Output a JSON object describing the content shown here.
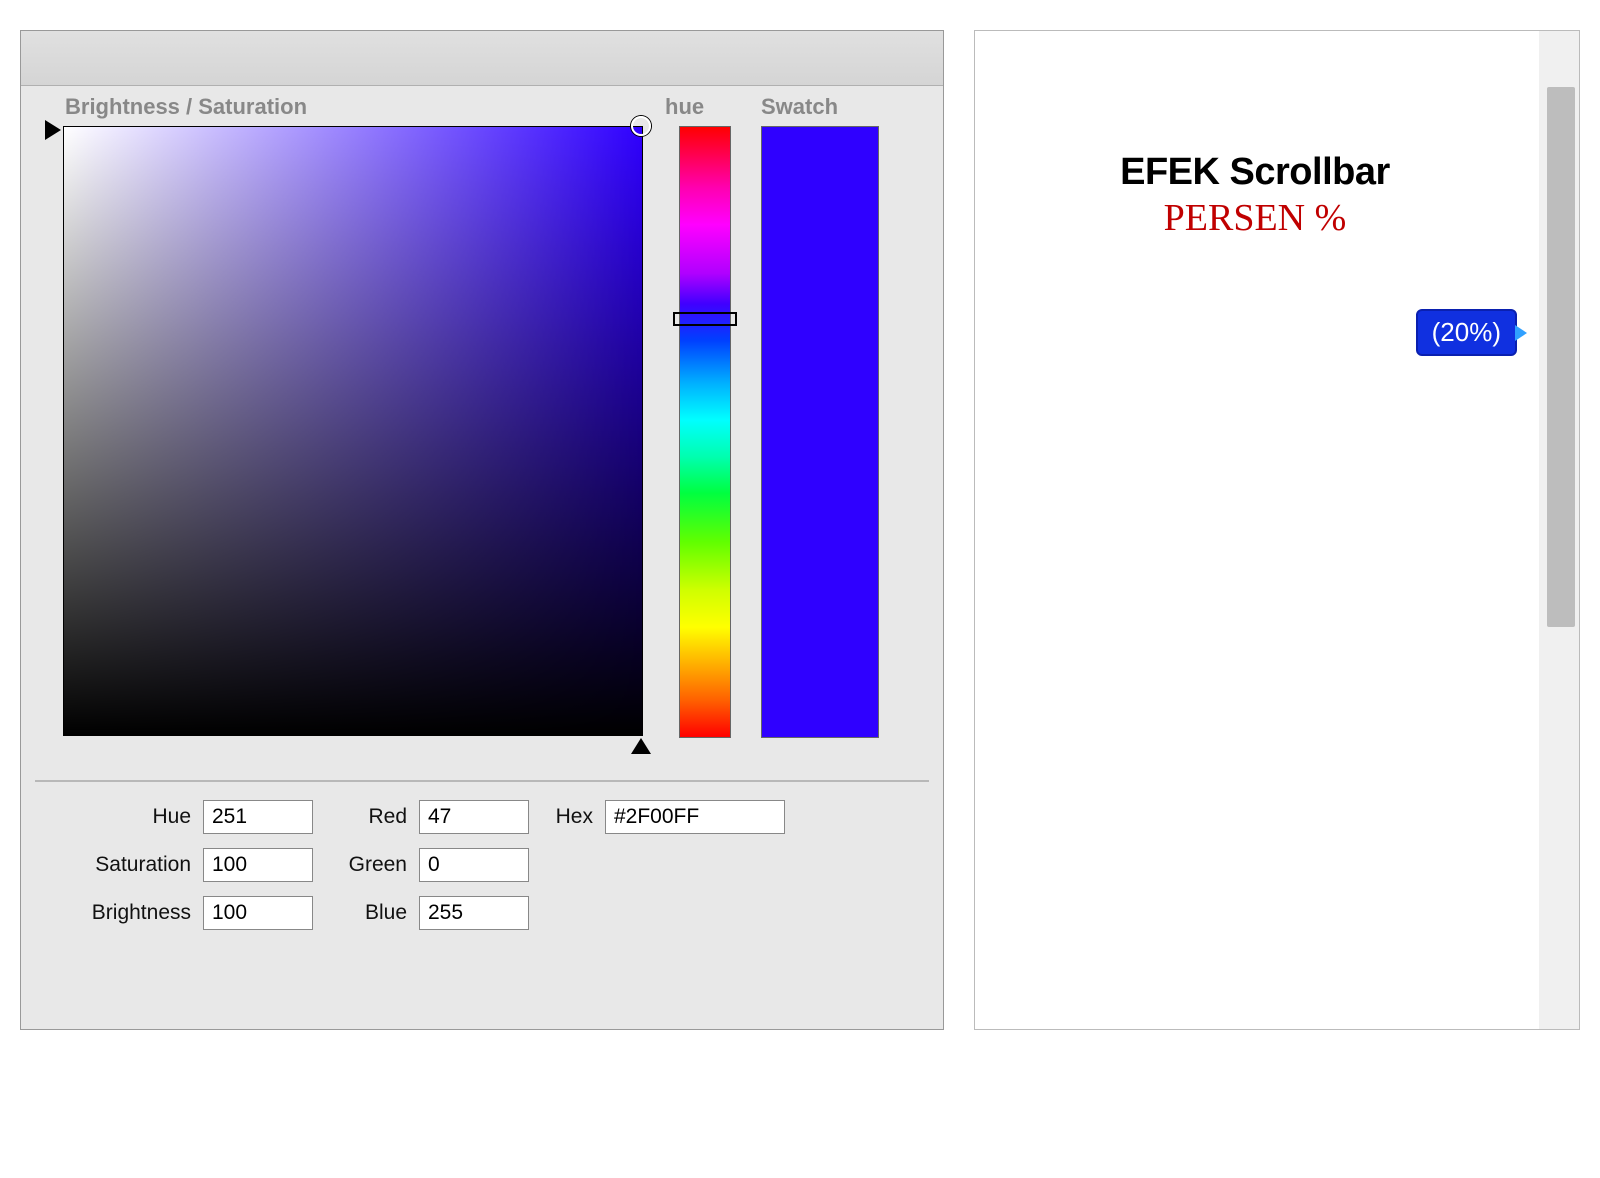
{
  "picker": {
    "labels": {
      "brightness_saturation": "Brightness / Saturation",
      "hue": "hue",
      "swatch": "Swatch"
    },
    "fields": {
      "hue_label": "Hue",
      "hue_value": "251",
      "saturation_label": "Saturation",
      "saturation_value": "100",
      "brightness_label": "Brightness",
      "brightness_value": "100",
      "red_label": "Red",
      "red_value": "47",
      "green_label": "Green",
      "green_value": "0",
      "blue_label": "Blue",
      "blue_value": "255",
      "hex_label": "Hex",
      "hex_value": "#2F00FF"
    },
    "swatch_color": "#2F00FF"
  },
  "scroll_demo": {
    "title1": "EFEK Scrollbar",
    "title2": "PERSEN %",
    "percent_badge": "(20%)"
  }
}
